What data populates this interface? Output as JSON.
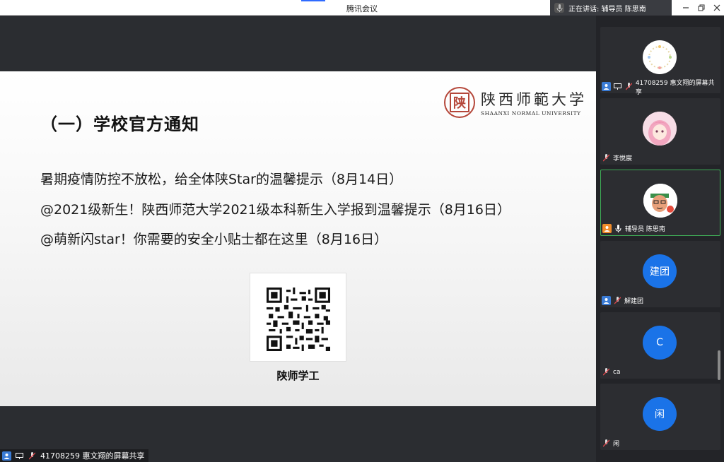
{
  "window": {
    "title": "腾讯会议",
    "speaking_label": "正在讲话: 辅导员 陈思南",
    "controls": [
      "minimize-icon",
      "restore-icon",
      "close-icon"
    ]
  },
  "slide": {
    "title": "（一）学校官方通知",
    "logo_cn": "陕西师範大学",
    "logo_en": "SHAANXI NORMAL UNIVERSITY",
    "seal_char": "陕",
    "notices": [
      "暑期疫情防控不放松，给全体陕Star的温馨提示（8月14日）",
      "@2021级新生！陕西师范大学2021级本科新生入学报到温馨提示（8月16日）",
      "@萌新闪star！你需要的安全小贴士都在这里（8月16日）"
    ],
    "qr_caption": "陕师学工"
  },
  "share_label": "41708259  惠文翔的屏幕共享",
  "participants": [
    {
      "name": "41708259  惠文翔的屏幕共享",
      "avatar": "wreath-image",
      "kind": "image",
      "color": "#ffffff",
      "screen": true
    },
    {
      "name": "李悦宸",
      "avatar": "anime-girl-image",
      "kind": "image",
      "color": "#f6c9d7",
      "screen": false
    },
    {
      "name": "辅导员 陈思南",
      "avatar": "cartoon-avatar-image",
      "kind": "image",
      "color": "#ffffff",
      "screen": false,
      "active": true
    },
    {
      "name": "解建团",
      "avatar_text": "建团",
      "kind": "text",
      "color": "#1a73e8",
      "screen": false
    },
    {
      "name": "ca",
      "avatar_text": "C",
      "kind": "text",
      "color": "#1a73e8",
      "screen": false
    },
    {
      "name": "闲",
      "avatar_text": "闲",
      "kind": "text",
      "color": "#1a73e8",
      "screen": false
    }
  ]
}
